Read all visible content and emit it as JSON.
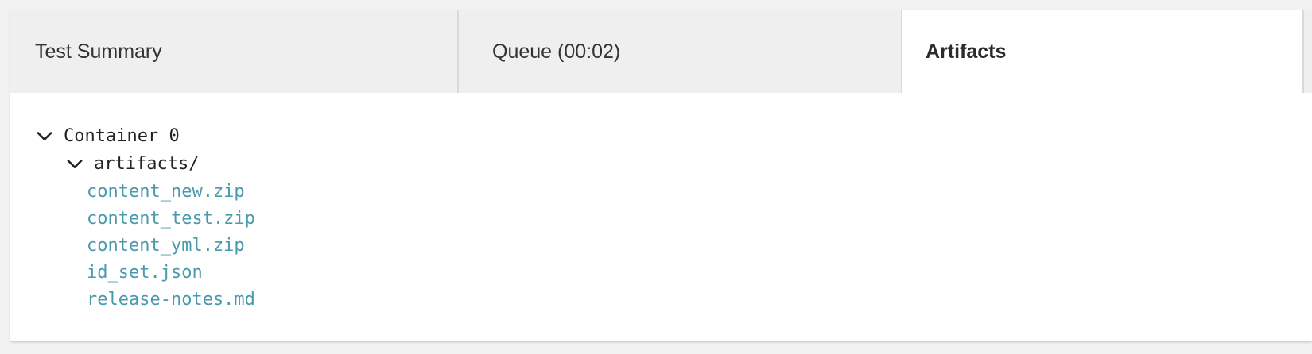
{
  "tabs": [
    {
      "label": "Test Summary",
      "active": false
    },
    {
      "label": "Queue (00:02)",
      "active": false
    },
    {
      "label": "Artifacts",
      "active": true
    }
  ],
  "tree": {
    "container": {
      "label": "Container 0",
      "expanded": true,
      "icon": "chevron-down-icon"
    },
    "folder": {
      "label": "artifacts/",
      "expanded": true,
      "icon": "chevron-down-icon"
    },
    "files": [
      "content_new.zip",
      "content_test.zip",
      "content_yml.zip",
      "id_set.json",
      "release-notes.md"
    ]
  },
  "colors": {
    "link": "#4a9aae",
    "tabbar_bg": "#efefef",
    "page_bg": "#f2f2f2"
  }
}
